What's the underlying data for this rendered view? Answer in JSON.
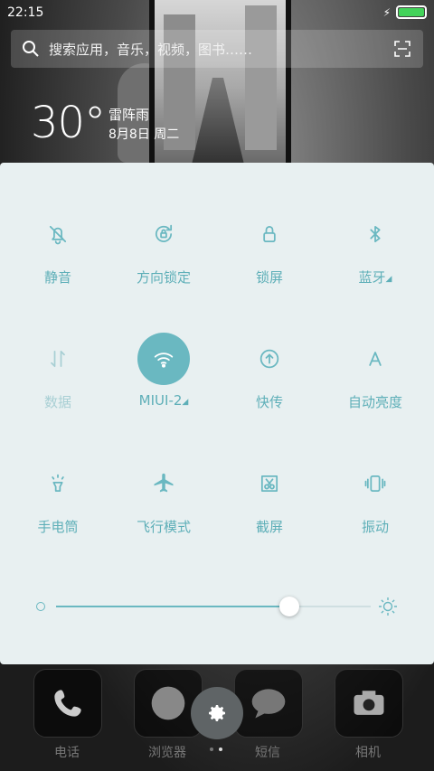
{
  "status_bar": {
    "time": "22:15",
    "battery_level": 1.0
  },
  "search": {
    "placeholder": "搜索应用，音乐，视频，图书……"
  },
  "weather": {
    "temperature": "30°",
    "condition": "雷阵雨",
    "date": "8月8日 周二"
  },
  "tiles": [
    {
      "label": "静音",
      "icon": "bell-off-icon",
      "active": false,
      "dim": false,
      "has_arrow": false
    },
    {
      "label": "方向锁定",
      "icon": "rotation-lock-icon",
      "active": false,
      "dim": false,
      "has_arrow": false
    },
    {
      "label": "锁屏",
      "icon": "lock-icon",
      "active": false,
      "dim": false,
      "has_arrow": false
    },
    {
      "label": "蓝牙",
      "icon": "bluetooth-icon",
      "active": false,
      "dim": false,
      "has_arrow": true
    },
    {
      "label": "数据",
      "icon": "data-icon",
      "active": false,
      "dim": true,
      "has_arrow": false
    },
    {
      "label": "MIUI-2",
      "icon": "wifi-icon",
      "active": true,
      "dim": false,
      "has_arrow": true
    },
    {
      "label": "快传",
      "icon": "transfer-icon",
      "active": false,
      "dim": false,
      "has_arrow": false
    },
    {
      "label": "自动亮度",
      "icon": "auto-brightness-icon",
      "active": false,
      "dim": false,
      "has_arrow": false
    },
    {
      "label": "手电筒",
      "icon": "flashlight-icon",
      "active": false,
      "dim": false,
      "has_arrow": false
    },
    {
      "label": "飞行模式",
      "icon": "airplane-icon",
      "active": false,
      "dim": false,
      "has_arrow": false
    },
    {
      "label": "截屏",
      "icon": "screenshot-icon",
      "active": false,
      "dim": false,
      "has_arrow": false
    },
    {
      "label": "振动",
      "icon": "vibrate-icon",
      "active": false,
      "dim": false,
      "has_arrow": false
    }
  ],
  "brightness": {
    "level": 0.74
  },
  "dock": [
    {
      "label": "电话",
      "icon": "phone-icon"
    },
    {
      "label": "浏览器",
      "icon": "browser-icon"
    },
    {
      "label": "短信",
      "icon": "message-icon"
    },
    {
      "label": "相机",
      "icon": "camera-icon"
    }
  ],
  "colors": {
    "accent": "#6ab8c1",
    "panel_bg": "#e8f0f1",
    "battery": "#43d35a"
  }
}
